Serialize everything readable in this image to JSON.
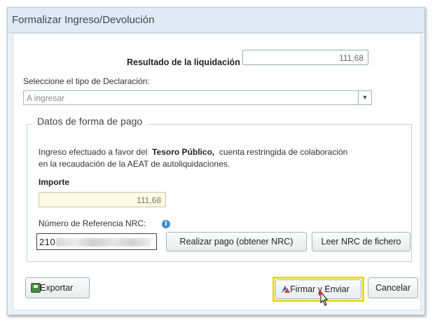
{
  "dialog": {
    "title": "Formalizar Ingreso/Devolución"
  },
  "result": {
    "label": "Resultado de la liquidación",
    "value": "111,68"
  },
  "declaration": {
    "label": "Seleccione el tipo de Declaración:",
    "selected": "A ingresar"
  },
  "payment": {
    "legend": "Datos de forma de pago",
    "info_prefix": "Ingreso efectuado a favor del",
    "info_bold": "Tesoro Público,",
    "info_suffix": "cuenta restringida de colaboración",
    "info_line2": "en la recaudación de la AEAT de autoliquidaciones.",
    "importe_label": "Importe",
    "importe_value": "111,68",
    "nrc_label": "Número de Referencia  NRC:",
    "nrc_value": "210",
    "pay_button": "Realizar pago (obtener NRC)",
    "read_button": "Leer NRC de fichero"
  },
  "footer": {
    "export_button": "Exportar",
    "sign_button": "Firmar y Enviar",
    "cancel_button": "Cancelar"
  },
  "icons": {
    "info": "info-icon",
    "export": "export-icon",
    "sign": "sign-send-icon",
    "dropdown": "chevron-down-icon",
    "cursor": "mouse-pointer-icon"
  },
  "colors": {
    "highlight": "#e4da2a",
    "importe_bg": "#fdfbe3",
    "info_icon": "#3d8fd1"
  }
}
